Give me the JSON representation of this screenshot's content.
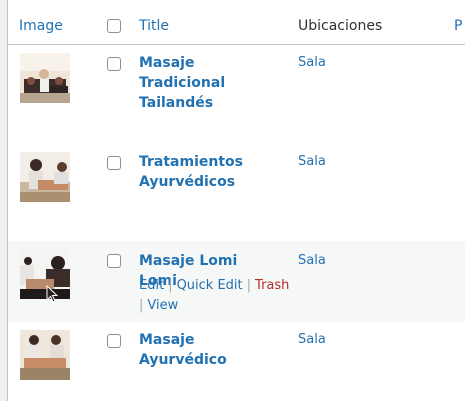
{
  "columns": {
    "image": "Image",
    "title": "Title",
    "locations": "Ubicaciones",
    "partial": "P"
  },
  "rows": [
    {
      "title": "Masaje Tradicional Tailandés",
      "location": "Sala"
    },
    {
      "title": "Tratamientos Ayurvédicos",
      "location": "Sala"
    },
    {
      "title": "Masaje Lomi Lomi",
      "location": "Sala"
    },
    {
      "title": "Masaje Ayurvédico",
      "location": "Sala"
    }
  ],
  "row_actions": {
    "edit": "Edit",
    "quick_edit": "Quick Edit",
    "trash": "Trash",
    "view": "View"
  },
  "colors": {
    "link": "#2271b1",
    "trash": "#b32d2e",
    "alt_row": "#f6f7f7"
  }
}
